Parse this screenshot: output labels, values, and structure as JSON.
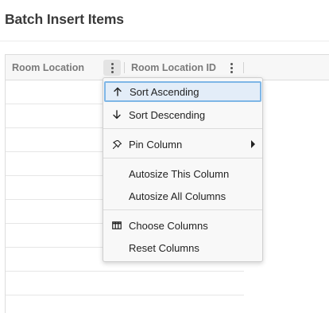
{
  "page": {
    "title": "Batch Insert Items"
  },
  "grid": {
    "columns": [
      {
        "label": "Room Location",
        "menu_icon": "vertical-dots-icon"
      },
      {
        "label": "Room Location ID",
        "menu_icon": "vertical-dots-icon"
      }
    ]
  },
  "column_menu": {
    "items": [
      {
        "label": "Sort Ascending",
        "icon": "arrow-up-icon",
        "highlighted": true
      },
      {
        "label": "Sort Descending",
        "icon": "arrow-down-icon"
      },
      {
        "label": "Pin Column",
        "icon": "pin-icon",
        "submenu": true
      },
      {
        "label": "Autosize This Column"
      },
      {
        "label": "Autosize All Columns"
      },
      {
        "label": "Choose Columns",
        "icon": "columns-icon"
      },
      {
        "label": "Reset Columns"
      }
    ]
  },
  "colors": {
    "highlight_border": "#7eb6e6",
    "highlight_fill": "#e3edf8",
    "header_bg": "#f7f7f7"
  }
}
